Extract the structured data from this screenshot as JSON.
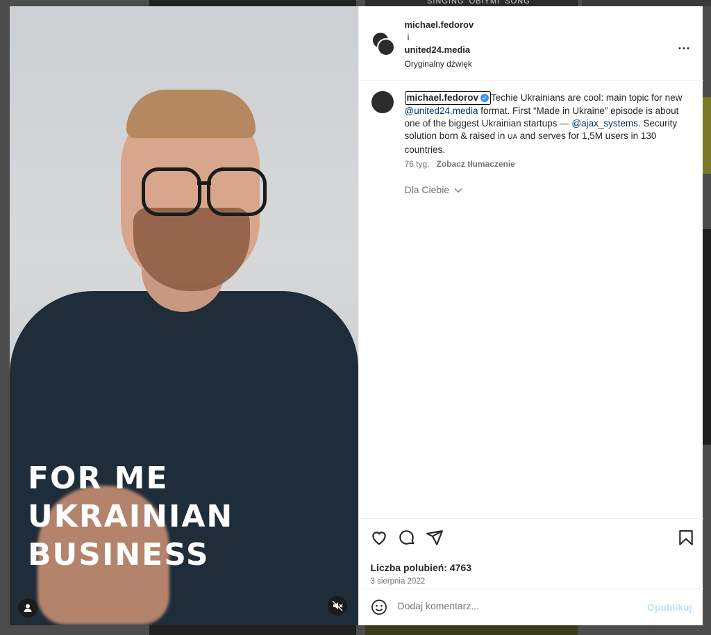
{
  "backdrop": {
    "caption_fragment": "SINGING 'OBIYMI' SONG"
  },
  "media": {
    "overlay_lines": [
      "FOR ME",
      "UKRAINIAN",
      "BUSINESS"
    ],
    "user_icon": "person-icon",
    "mute_icon": "speaker-muted-icon"
  },
  "header": {
    "author": "michael.fedorov",
    "joiner": "i",
    "coauthor": "united24.media",
    "audio": "Oryginalny dźwięk",
    "more_icon": "more-horizontal-icon",
    "more_label": "..."
  },
  "caption": {
    "username": "michael.fedorov",
    "verified_icon": "verified-badge-icon",
    "verified_glyph": "✓",
    "text_1": "Techie Ukrainians are cool: main topic for new ",
    "mention_1": "@united24.media",
    "text_2": " format. First “Made in Ukraine” episode is about one of the biggest Ukrainian startups — ",
    "mention_2": "@ajax_systems",
    "text_3": ". Security solution born & raised in ",
    "text_ua": "UA",
    "text_4": " and serves for 1,5M users in 130 countries.",
    "age": "76 tyg.",
    "translate": "Zobacz tłumaczenie"
  },
  "for_you": {
    "label": "Dla Ciebie",
    "chevron_icon": "chevron-down-icon"
  },
  "actions": {
    "like_icon": "heart-icon",
    "comment_icon": "comment-icon",
    "share_icon": "send-icon",
    "save_icon": "bookmark-icon",
    "likes": "Liczba polubień: 4763",
    "date": "3 sierpnia 2022"
  },
  "comment": {
    "emoji_icon": "emoji-icon",
    "placeholder": "Dodaj komentarz...",
    "publish": "Opublikuj"
  },
  "colors": {
    "accent": "#0095f6",
    "publish_disabled": "#c0dffd",
    "mention": "#00376b",
    "verified": "#3897f0"
  }
}
